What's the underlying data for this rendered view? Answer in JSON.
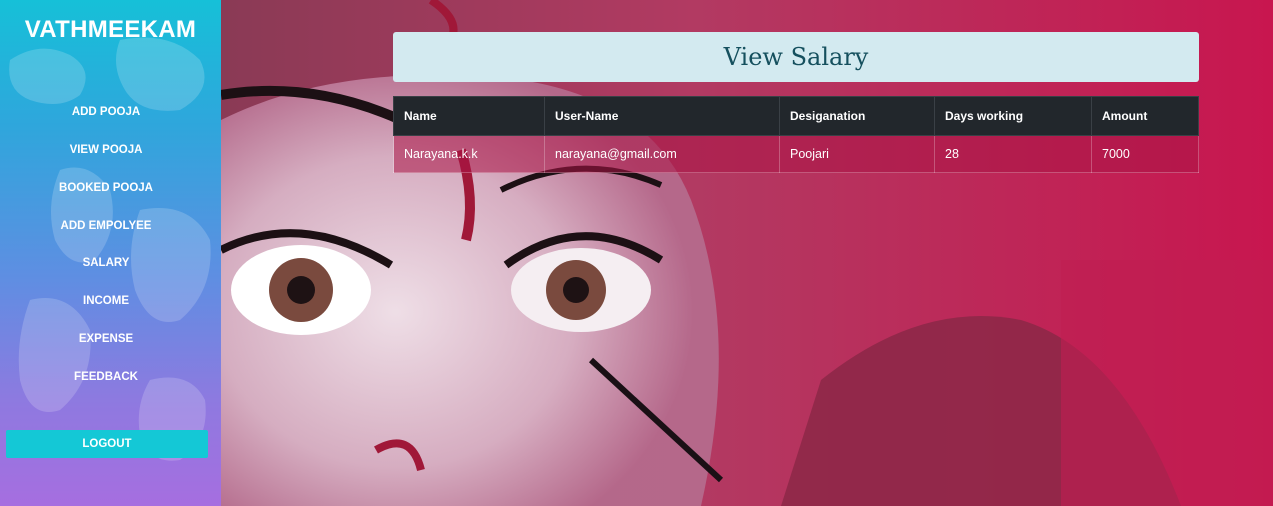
{
  "brand": "VATHMEEKAM",
  "sidebar": {
    "items": [
      {
        "label": "ADD POOJA"
      },
      {
        "label": "VIEW POOJA"
      },
      {
        "label": "BOOKED POOJA"
      },
      {
        "label": "ADD EMPOLYEE"
      },
      {
        "label": "SALARY"
      },
      {
        "label": "INCOME"
      },
      {
        "label": "EXPENSE"
      },
      {
        "label": "FEEDBACK"
      }
    ],
    "logout_label": "LOGOUT"
  },
  "page": {
    "title": "View Salary"
  },
  "table": {
    "headers": [
      "Name",
      "User-Name",
      "Desiganation",
      "Days working",
      "Amount"
    ],
    "rows": [
      [
        "Narayana.k.k",
        "narayana@gmail.com",
        "Poojari",
        "28",
        "7000"
      ]
    ]
  },
  "colors": {
    "sidebar_top": "#16c0d8",
    "sidebar_bottom": "#a66ee0",
    "logout_button": "#14c8d6",
    "title_box": "#d3eaf0",
    "table_header": "#22272c",
    "overlay": "#c2244f"
  },
  "icons": [
    "world-map-background",
    "deity-painting-background"
  ]
}
